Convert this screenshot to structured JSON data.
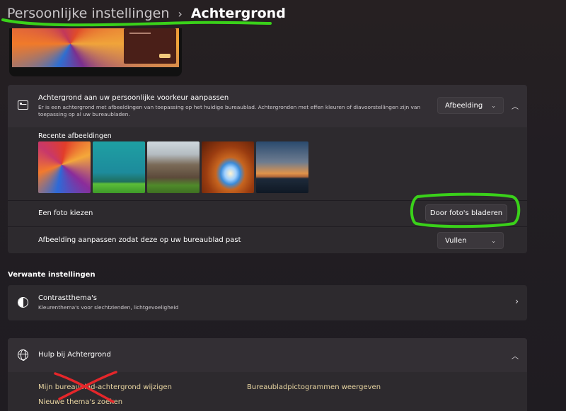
{
  "breadcrumb": {
    "parent": "Persoonlijke instellingen",
    "separator": "›",
    "current": "Achtergrond"
  },
  "background_section": {
    "title": "Achtergrond aan uw persoonlijke voorkeur aanpassen",
    "description": "Er is een achtergrond met afbeeldingen van toepassing op het huidige bureaublad. Achtergronden met effen kleuren of diavoorstellingen zijn van toepassing op al uw bureaubladen.",
    "type_value": "Afbeelding",
    "recent_label": "Recente afbeeldingen",
    "choose_photo_label": "Een foto kiezen",
    "browse_button": "Door foto's bladeren",
    "fit_label": "Afbeelding aanpassen zodat deze op uw bureaublad past",
    "fit_value": "Vullen"
  },
  "related": {
    "title": "Verwante instellingen",
    "contrast_title": "Contrastthema's",
    "contrast_desc": "Kleurenthema's voor slechtzienden, lichtgevoeligheid"
  },
  "help": {
    "title": "Hulp bij Achtergrond",
    "link_1": "Mijn bureaublad-achtergrond wijzigen",
    "link_2": "Bureaubladpictogrammen weergeven",
    "link_3": "Nieuwe thema's zoeken"
  },
  "icons": {
    "background": "image-icon",
    "contrast": "contrast-icon",
    "help": "globe-icon"
  },
  "colors": {
    "link": "#e9d6a2",
    "annotation_green": "#3ad11a",
    "annotation_red": "#e5262a"
  }
}
